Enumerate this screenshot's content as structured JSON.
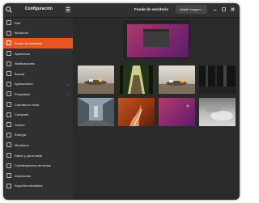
{
  "sidebar": {
    "title": "Configuración",
    "items": [
      {
        "label": "Red",
        "icon": "network-icon"
      },
      {
        "label": "Bluetooth",
        "icon": "bluetooth-icon"
      },
      {
        "label": "Fondo de escritorio",
        "icon": "wallpaper-icon",
        "active": true
      },
      {
        "label": "Apariencia",
        "icon": "appearance-icon"
      },
      {
        "label": "Notificaciones",
        "icon": "bell-icon"
      },
      {
        "label": "Buscar",
        "icon": "search-icon"
      },
      {
        "label": "Aplicaciones",
        "icon": "apps-icon",
        "arrow": true
      },
      {
        "label": "Privacidad",
        "icon": "hand-icon",
        "arrow": true
      },
      {
        "label": "Cuentas en línea",
        "icon": "cloud-icon"
      },
      {
        "label": "Compartir",
        "icon": "share-icon"
      },
      {
        "label": "Sonido",
        "icon": "speaker-icon"
      },
      {
        "label": "Energía",
        "icon": "power-icon"
      },
      {
        "label": "Monitores",
        "icon": "monitor-icon"
      },
      {
        "label": "Ratón y panel táctil",
        "icon": "mouse-icon"
      },
      {
        "label": "Combinaciones de teclas",
        "icon": "keyboard-icon"
      },
      {
        "label": "Impresoras",
        "icon": "printer-icon"
      },
      {
        "label": "Soportes extraíbles",
        "icon": "media-icon"
      }
    ]
  },
  "header": {
    "title": "Fondo de escritorio",
    "add_button": "Añadir imagen..."
  },
  "colors": {
    "accent": "#e95420",
    "window_bg": "#2a2a2a",
    "sidebar_bg": "#303030"
  },
  "wallpapers": [
    {
      "name": "wallpaper-cafe-table"
    },
    {
      "name": "wallpaper-forest-path"
    },
    {
      "name": "wallpaper-cafe-table-2"
    },
    {
      "name": "wallpaper-dark-forest"
    },
    {
      "name": "wallpaper-city-street"
    },
    {
      "name": "wallpaper-orange-abstract"
    },
    {
      "name": "wallpaper-purple-gradient"
    },
    {
      "name": "wallpaper-grey-abstract"
    }
  ]
}
